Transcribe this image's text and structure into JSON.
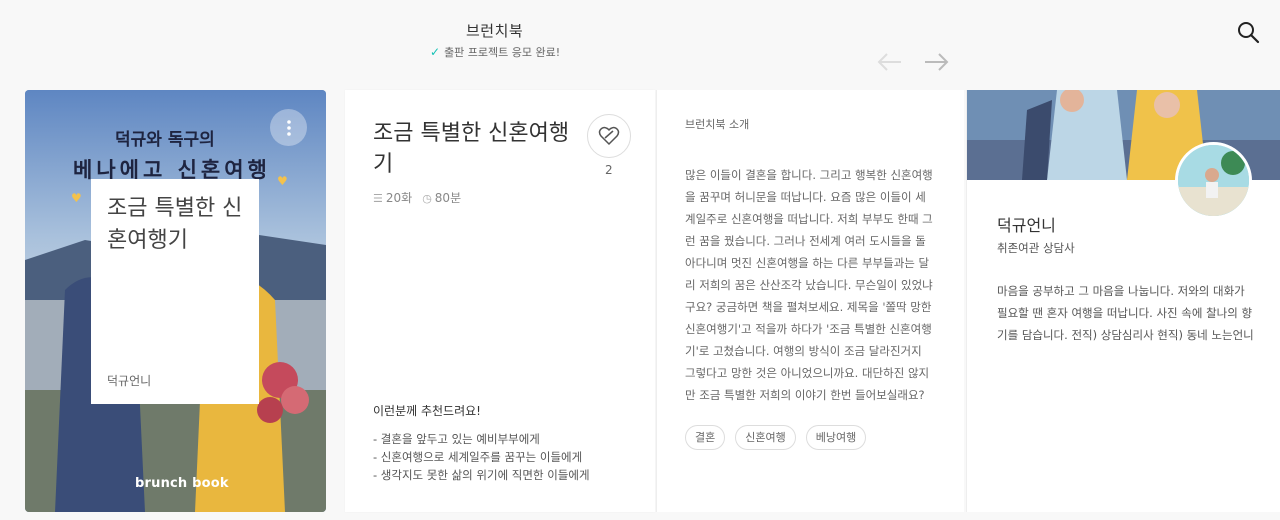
{
  "header": {
    "brand_title": "브런치북",
    "status_text": "출판 프로젝트 응모 완료!",
    "check_icon": "check-icon",
    "search_icon": "search-icon",
    "prev_icon": "arrow-left-icon",
    "next_icon": "arrow-right-icon"
  },
  "cover": {
    "title": "조금 특별한 신혼여행기",
    "author": "덕규언니",
    "logo": "brunch book",
    "hand_title_1": "덕규와 독구의",
    "hand_title_2": "베나에고 신혼여행",
    "more_icon": "more-vertical-icon"
  },
  "book_info": {
    "title": "조금 특별한 신혼여행기",
    "like_count": "2",
    "episodes": "20화",
    "minutes": "80분",
    "recommend_heading": "이런분께 추천드려요!",
    "recommend_items": [
      "- 결혼을 앞두고 있는 예비부부에게",
      "- 신혼여행으로 세계일주를 꿈꾸는 이들에게",
      "- 생각지도 못한 삶의 위기에 직면한 이들에게"
    ]
  },
  "intro": {
    "heading": "브런치북 소개",
    "body": "많은 이들이 결혼을 합니다. 그리고 행복한 신혼여행을 꿈꾸며 허니문을 떠납니다. 요즘 많은 이들이 세계일주로 신혼여행을 떠납니다. 저희 부부도 한때 그런 꿈을 꿨습니다. 그러나 전세계 여러 도시들을 돌아다니며 멋진 신혼여행을 하는 다른 부부들과는 달리 저희의 꿈은 산산조각 났습니다. 무슨일이 있었냐구요? 궁금하면 책을 펼쳐보세요. 제목을 '쫄딱 망한 신혼여행기'고 적을까 하다가 '조금 특별한 신혼여행기'로 고쳤습니다. 여행의 방식이 조금 달라진거지 그렇다고 망한 것은 아니었으니까요. 대단하진 않지만 조금 특별한 저희의 이야기 한번 들어보실래요?",
    "tags": [
      "결혼",
      "신혼여행",
      "베낭여행"
    ]
  },
  "author": {
    "name": "덕규언니",
    "job": "취존여관 상담사",
    "description": "마음을 공부하고 그 마음을 나눕니다. 저와의 대화가 필요할 땐 혼자 여행을 떠납니다. 사진 속에 찰나의 향기를 담습니다. 전직) 상담심리사 현직) 동네 노는언니"
  },
  "colors": {
    "accent": "#16c2b6",
    "cover_bg": "#6d8fb7"
  }
}
